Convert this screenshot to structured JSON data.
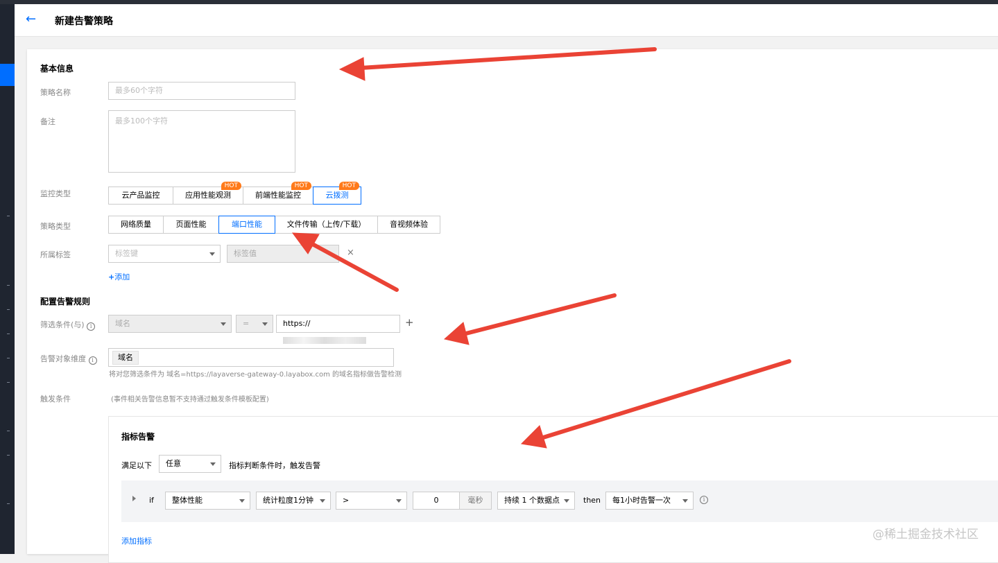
{
  "header": {
    "back_icon": "←",
    "title": "新建告警策略"
  },
  "basic": {
    "section_title": "基本信息",
    "name_label": "策略名称",
    "name_placeholder": "最多60个字符",
    "remark_label": "备注",
    "remark_placeholder": "最多100个字符",
    "monitor_type_label": "监控类型",
    "monitor_types": [
      "云产品监控",
      "应用性能观测",
      "前端性能监控",
      "云拨测"
    ],
    "hot_badge": "HOT",
    "policy_type_label": "策略类型",
    "policy_types": [
      "网络质量",
      "页面性能",
      "端口性能",
      "文件传输（上传/下载）",
      "音视频体验"
    ],
    "tag_label": "所属标签",
    "tag_key_placeholder": "标签键",
    "tag_value_placeholder": "标签值",
    "tag_remove_icon": "×",
    "add_link": "添加"
  },
  "rules": {
    "section_title": "配置告警规则",
    "filter_label": "筛选条件(与)",
    "filter_field": "域名",
    "filter_op": "=",
    "filter_value": "https://",
    "dimension_label": "告警对象维度",
    "dimension_tag": "域名",
    "dimension_hint": "将对您筛选条件为 域名=https://layaverse-gateway-0.layabox.com 的域名指标做告警检测",
    "trigger_label": "触发条件",
    "trigger_hint": "(事件相关告警信息暂不支持通过触发条件模板配置)"
  },
  "metric": {
    "title": "指标告警",
    "satisfy_prefix": "满足以下",
    "satisfy_select": "任意",
    "satisfy_suffix": "指标判断条件时，触发告警",
    "if_label": "if",
    "metric_select": "整体性能",
    "granularity_select": "统计粒度1分钟",
    "operator_select": ">",
    "threshold_value": "0",
    "unit": "毫秒",
    "duration_select": "持续 1 个数据点",
    "then_label": "then",
    "frequency_select": "每1小时告警一次",
    "add_metric_link": "添加指标"
  },
  "watermark": "@稀土掘金技术社区",
  "colors": {
    "accent": "#006eff",
    "hot": "#ff7a1a",
    "arrow": "#ea4335"
  }
}
